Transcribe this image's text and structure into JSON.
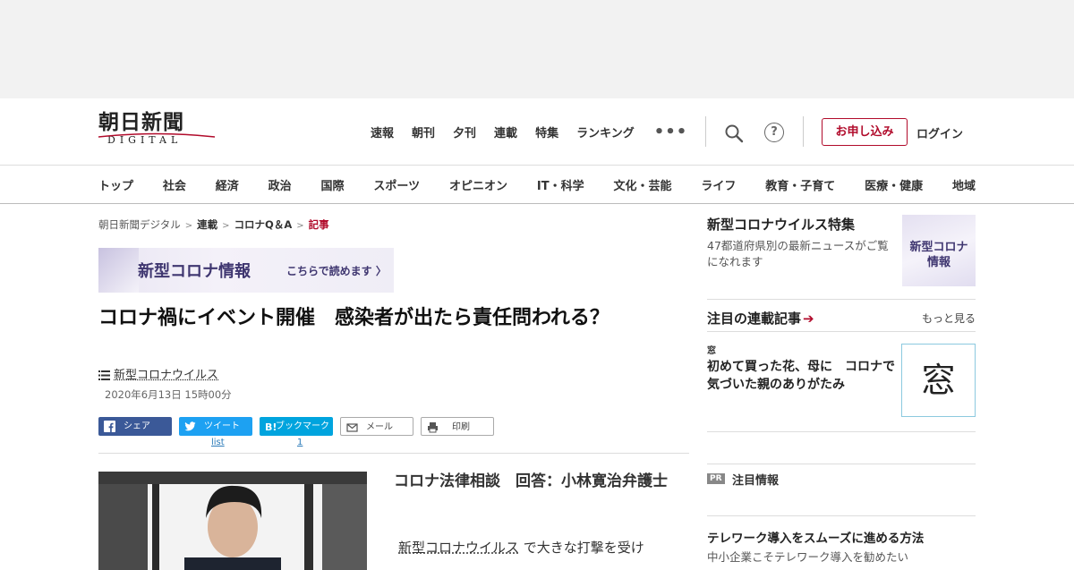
{
  "header": {
    "logo_main": "朝日新聞",
    "logo_sub": "DIGITAL",
    "top_nav": [
      "速報",
      "朝刊",
      "夕刊",
      "連載",
      "特集",
      "ランキング"
    ],
    "subscribe_label": "お申し込み",
    "login_label": "ログイン",
    "help_glyph": "?",
    "more_glyph": "•••"
  },
  "category_nav": [
    "トップ",
    "社会",
    "経済",
    "政治",
    "国際",
    "スポーツ",
    "オピニオン",
    "IT・科学",
    "文化・芸能",
    "ライフ",
    "教育・子育て",
    "医療・健康",
    "地域"
  ],
  "breadcrumb": {
    "items": [
      "朝日新聞デジタル",
      "連載",
      "コロナQ＆A"
    ],
    "current": "記事",
    "separator": ">"
  },
  "banner": {
    "title": "新型コロナ情報",
    "sub": "こちらで読めます 〉"
  },
  "article": {
    "headline": "コロナ禍にイベント開催　感染者が出たら責任問われる？",
    "tag": "新型コロナウイルス",
    "date": "2020年6月13日 15時00分",
    "subtitle": "コロナ法律相談　回答：小林寛治弁護士",
    "lead_keyword": "新型コロナウイルス",
    "lead_rest": " で大きな打撃を受け"
  },
  "share": {
    "facebook": "シェア",
    "twitter": "ツイート",
    "hatena": "ブックマーク",
    "mail": "メール",
    "print": "印刷",
    "twitter_count": "list",
    "hatena_count": "1"
  },
  "sidebar": {
    "feature_title": "新型コロナウイルス特集",
    "feature_desc": "47都道府県別の最新ニュースがご覧になれます",
    "feature_thumb": "新型コロナ 情報",
    "rensai_heading": "注目の連載記事",
    "rensai_more": "もっと見る",
    "rensai_label": "窓",
    "rensai_title": "初めて買った花、母に　コロナで気づいた親のありがたみ",
    "rensai_thumb_char": "窓",
    "pr_badge": "PR",
    "pr_title": "注目情報",
    "item_title": "テレワーク導入をスムーズに進める方法",
    "item_desc": "中小企業こそテレワーク導入を勧めたい"
  },
  "colors": {
    "brand_red": "#b10b2b",
    "corona_purple": "#3f3670",
    "facebook": "#3b5998",
    "twitter": "#1da1f2",
    "hatena": "#00a4de"
  }
}
